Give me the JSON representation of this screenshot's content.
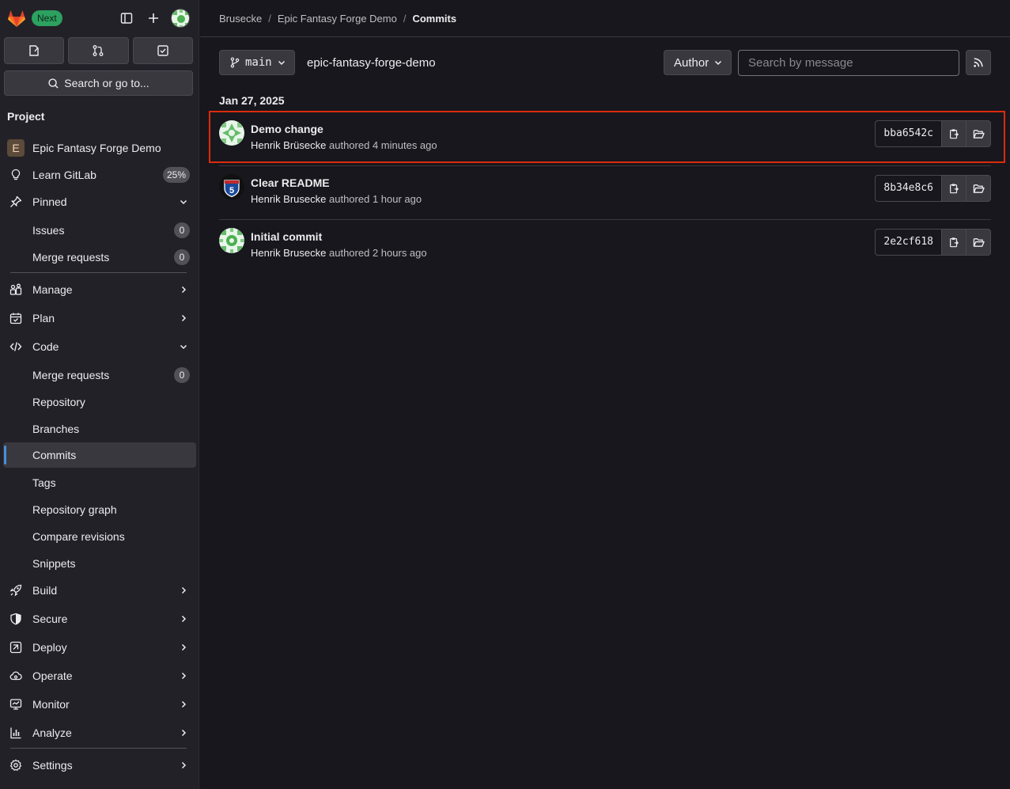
{
  "topbar": {
    "next_badge": "Next"
  },
  "sidebar": {
    "search_label": "Search or go to...",
    "section_title": "Project",
    "project": {
      "initial": "E",
      "name": "Epic Fantasy Forge Demo"
    },
    "learn_gitlab": {
      "label": "Learn GitLab",
      "badge": "25%"
    },
    "pinned": {
      "label": "Pinned",
      "items": [
        {
          "label": "Issues",
          "count": "0"
        },
        {
          "label": "Merge requests",
          "count": "0"
        }
      ]
    },
    "manage": "Manage",
    "plan": "Plan",
    "code": {
      "label": "Code",
      "items": [
        {
          "label": "Merge requests",
          "count": "0"
        },
        {
          "label": "Repository"
        },
        {
          "label": "Branches"
        },
        {
          "label": "Commits"
        },
        {
          "label": "Tags"
        },
        {
          "label": "Repository graph"
        },
        {
          "label": "Compare revisions"
        },
        {
          "label": "Snippets"
        }
      ]
    },
    "build": "Build",
    "secure": "Secure",
    "deploy": "Deploy",
    "operate": "Operate",
    "monitor": "Monitor",
    "analyze": "Analyze",
    "settings": "Settings"
  },
  "breadcrumb": {
    "items": [
      "Brusecke",
      "Epic Fantasy Forge Demo",
      "Commits"
    ]
  },
  "toolbar": {
    "branch": "main",
    "path": "epic-fantasy-forge-demo",
    "author_label": "Author",
    "search_placeholder": "Search by message"
  },
  "commits": {
    "date": "Jan 27, 2025",
    "items": [
      {
        "title": "Demo change",
        "author": "Henrik Brüsecke",
        "authored": "authored",
        "time": "4 minutes ago",
        "sha": "bba6542c"
      },
      {
        "title": "Clear README",
        "author": "Henrik Brusecke",
        "authored": "authored",
        "time": "1 hour ago",
        "sha": "8b34e8c6"
      },
      {
        "title": "Initial commit",
        "author": "Henrik Brusecke",
        "authored": "authored",
        "time": "2 hours ago",
        "sha": "2e2cf618"
      }
    ]
  },
  "colors": {
    "accent_blue": "#428fdc",
    "next_green": "#2da160",
    "highlight_red": "#dd2b0e"
  }
}
